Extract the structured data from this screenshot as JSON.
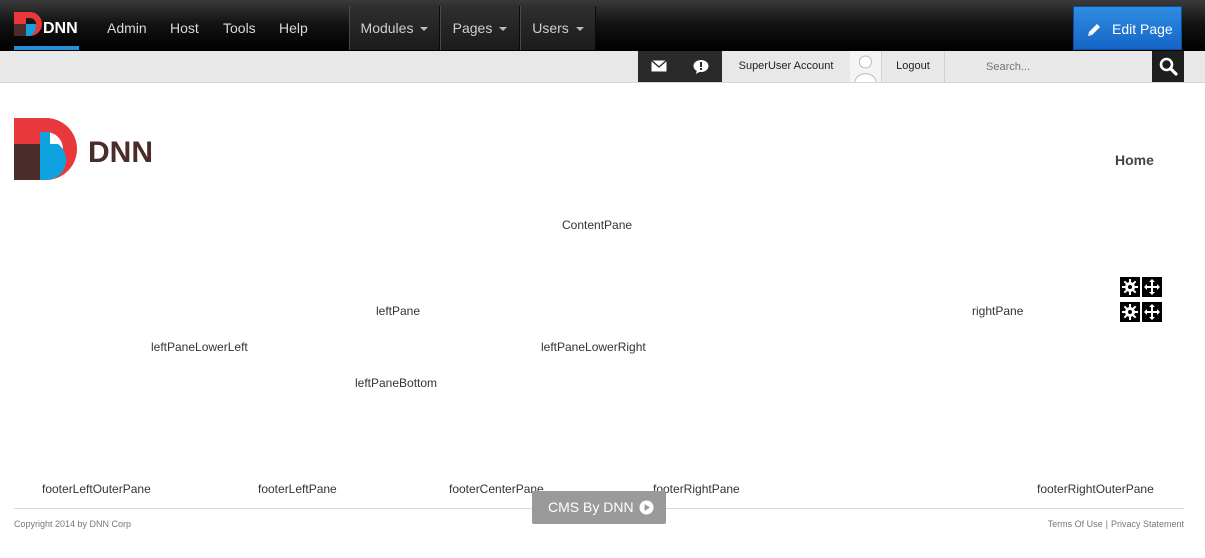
{
  "control_bar": {
    "nav": [
      "Admin",
      "Host",
      "Tools",
      "Help"
    ],
    "dropdowns": [
      "Modules",
      "Pages",
      "Users"
    ],
    "edit_page": "Edit Page",
    "accent": "#1b76d2"
  },
  "user_bar": {
    "user_name": "SuperUser Account",
    "logout": "Logout",
    "search_placeholder": "Search..."
  },
  "header": {
    "logo_text": "DNN",
    "nav_home": "Home"
  },
  "panes": {
    "content": "ContentPane",
    "left": "leftPane",
    "right": "rightPane",
    "left_lower_left": "leftPaneLowerLeft",
    "left_lower_right": "leftPaneLowerRight",
    "left_bottom": "leftPaneBottom",
    "footer_left_outer": "footerLeftOuterPane",
    "footer_left": "footerLeftPane",
    "footer_center": "footerCenterPane",
    "footer_right": "footerRightPane",
    "footer_right_outer": "footerRightOuterPane"
  },
  "footer": {
    "copyright": "Copyright 2014 by DNN Corp",
    "terms": "Terms Of Use",
    "separator": "|",
    "privacy": "Privacy Statement",
    "cms_badge": "CMS By DNN"
  },
  "icons": {
    "control_bar": [
      "dnn-logo-icon",
      "pencil-icon",
      "envelope-icon",
      "notification-icon",
      "avatar-icon",
      "search-icon"
    ],
    "module_actions": [
      "gear-icon",
      "move-icon"
    ],
    "badge": "play-circle-icon"
  },
  "colors": {
    "logo_red": "#e8383b",
    "logo_blue": "#0ea3e0",
    "logo_dark": "#4a2c2a",
    "edit_page_blue": "#1b76d2"
  }
}
